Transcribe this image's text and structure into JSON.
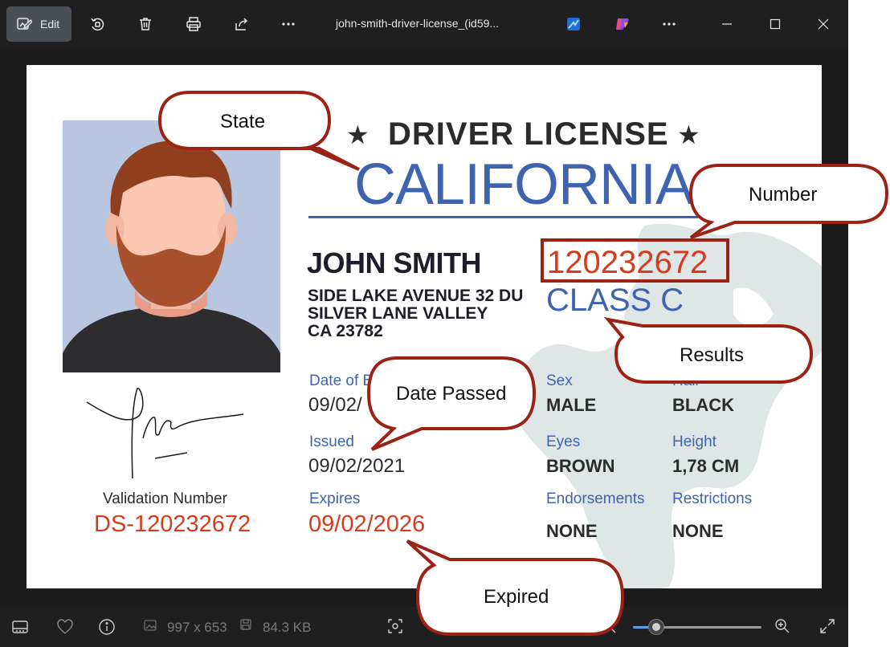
{
  "toolbar": {
    "edit_label": "Edit",
    "file_title": "john-smith-driver-license_(id59..."
  },
  "license": {
    "title": "DRIVER LICENSE",
    "state": "CALIFORNIA",
    "holder_name": "JOHN SMITH",
    "address_line1": "SIDE LAKE AVENUE 32 DU",
    "address_line2": "SILVER LANE VALLEY",
    "address_line3": "CA 23782",
    "number": "120232672",
    "class": "CLASS C",
    "dob_label": "Date of B",
    "dob_value": "09/02/",
    "issued_label": "Issued",
    "issued_value": "09/02/2021",
    "expires_label": "Expires",
    "expires_value": "09/02/2026",
    "sex_label": "Sex",
    "sex_value": "MALE",
    "hair_label": "Hair",
    "hair_value": "BLACK",
    "eyes_label": "Eyes",
    "eyes_value": "BROWN",
    "height_label": "Height",
    "height_value": "1,78 CM",
    "endorsements_label": "Endorsements",
    "endorsements_value": "NONE",
    "restrictions_label": "Restrictions",
    "restrictions_value": "NONE",
    "validation_label": "Validation Number",
    "validation_number": "DS-120232672"
  },
  "callouts": {
    "state": "State",
    "number": "Number",
    "results": "Results",
    "date_passed": "Date Passed",
    "expired": "Expired"
  },
  "statusbar": {
    "dimensions": "997 x 653",
    "file_size": "84.3 KB",
    "zoom_level": 0.18
  },
  "colors": {
    "accent_blue": "#3e63b0",
    "highlight_red": "#d63b1c",
    "callout_border": "#9b2214"
  }
}
